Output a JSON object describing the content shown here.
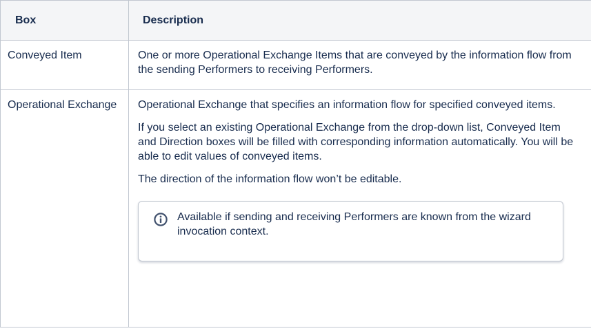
{
  "table": {
    "headers": {
      "box": "Box",
      "description": "Description"
    },
    "rows": [
      {
        "box": "Conveyed Item",
        "paragraphs": [
          "One or more Operational Exchange Items that are conveyed by the information flow from the sending Performers to receiving Performers."
        ]
      },
      {
        "box": "Operational Exchange",
        "paragraphs": [
          "Operational Exchange that specifies an information flow for specified conveyed items.",
          "If you select an existing Operational Exchange from the drop-down list, Conveyed Item and Direction boxes will be filled with corresponding information automatically. You will be able to edit values of conveyed items.",
          "The direction of the information flow won’t be editable."
        ],
        "info_panel": {
          "icon": "info-icon",
          "text": "Available if sending and receiving Performers are known from the wizard invocation context."
        }
      }
    ]
  },
  "colors": {
    "header_background": "#f4f5f7",
    "border": "#c1c7d0",
    "text": "#172b4d",
    "info_icon": "#42526e"
  }
}
